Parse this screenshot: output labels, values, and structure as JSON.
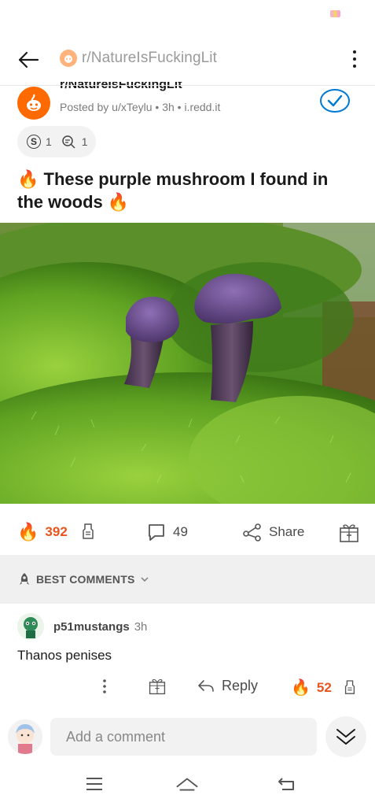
{
  "topbar": {
    "title": "r/NatureIsFuckingLit"
  },
  "post": {
    "subreddit": "r/NatureIsFuckingLit",
    "posted_by": "Posted by u/xTeylu • 3h • i.redd.it",
    "awards": {
      "silver_count": "1",
      "helpful_count": "1"
    },
    "title_prefix_emoji": "🔥",
    "title_text": " These purple mushroom I found in the woods ",
    "title_suffix_emoji": "🔥"
  },
  "actions": {
    "votes": "392",
    "comments": "49",
    "share_label": "Share"
  },
  "comments_section": {
    "sort_label": "BEST COMMENTS"
  },
  "comment": {
    "username": "p51mustangs",
    "time": "3h",
    "body": "Thanos penises",
    "reply_label": "Reply",
    "votes": "52"
  },
  "composer": {
    "placeholder": "Add a comment"
  },
  "colors": {
    "accent_vote": "#e8541e",
    "subreddit_orange": "#ff6a00",
    "join_blue": "#0079d3"
  }
}
